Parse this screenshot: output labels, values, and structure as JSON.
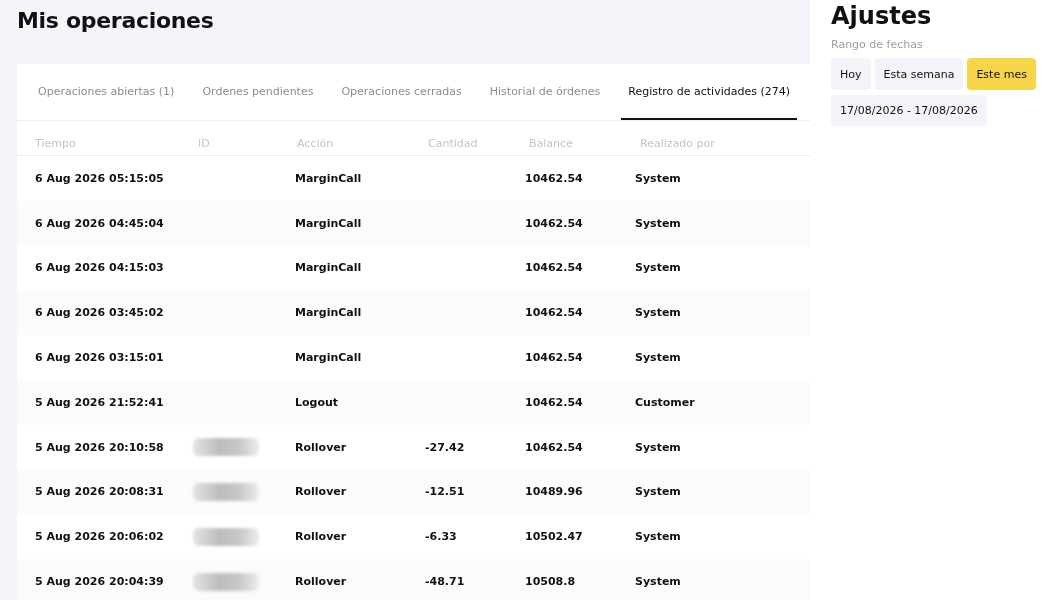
{
  "page_title": "Mis operaciones",
  "tabs": [
    {
      "label": "Operaciones abiertas (1)",
      "selected": false
    },
    {
      "label": "Ordenes pendientes",
      "selected": false
    },
    {
      "label": "Operaciones cerradas",
      "selected": false
    },
    {
      "label": "Historial de órdenes",
      "selected": false
    },
    {
      "label": "Registro de actividades (274)",
      "selected": true
    }
  ],
  "table": {
    "columns": [
      "Tiempo",
      "ID",
      "Acción",
      "Cantidad",
      "Balance",
      "Realizado por"
    ],
    "rows": [
      {
        "time": "6 Aug 2026 05:15:05",
        "id_redacted": false,
        "action": "MarginCall",
        "amount": "",
        "balance": "10462.54",
        "by": "System"
      },
      {
        "time": "6 Aug 2026 04:45:04",
        "id_redacted": false,
        "action": "MarginCall",
        "amount": "",
        "balance": "10462.54",
        "by": "System"
      },
      {
        "time": "6 Aug 2026 04:15:03",
        "id_redacted": false,
        "action": "MarginCall",
        "amount": "",
        "balance": "10462.54",
        "by": "System"
      },
      {
        "time": "6 Aug 2026 03:45:02",
        "id_redacted": false,
        "action": "MarginCall",
        "amount": "",
        "balance": "10462.54",
        "by": "System"
      },
      {
        "time": "6 Aug 2026 03:15:01",
        "id_redacted": false,
        "action": "MarginCall",
        "amount": "",
        "balance": "10462.54",
        "by": "System"
      },
      {
        "time": "5 Aug 2026 21:52:41",
        "id_redacted": false,
        "action": "Logout",
        "amount": "",
        "balance": "10462.54",
        "by": "Customer"
      },
      {
        "time": "5 Aug 2026 20:10:58",
        "id_redacted": true,
        "action": "Rollover",
        "amount": "-27.42",
        "balance": "10462.54",
        "by": "System"
      },
      {
        "time": "5 Aug 2026 20:08:31",
        "id_redacted": true,
        "action": "Rollover",
        "amount": "-12.51",
        "balance": "10489.96",
        "by": "System"
      },
      {
        "time": "5 Aug 2026 20:06:02",
        "id_redacted": true,
        "action": "Rollover",
        "amount": "-6.33",
        "balance": "10502.47",
        "by": "System"
      },
      {
        "time": "5 Aug 2026 20:04:39",
        "id_redacted": true,
        "action": "Rollover",
        "amount": "-48.71",
        "balance": "10508.8",
        "by": "System"
      }
    ]
  },
  "settings": {
    "title": "Ajustes",
    "date_range_label": "Rango de fechas",
    "presets": [
      {
        "label": "Hoy",
        "selected": false
      },
      {
        "label": "Esta semana",
        "selected": false
      },
      {
        "label": "Este mes",
        "selected": true
      }
    ],
    "date_range": "17/08/2026 - 17/08/2026"
  }
}
